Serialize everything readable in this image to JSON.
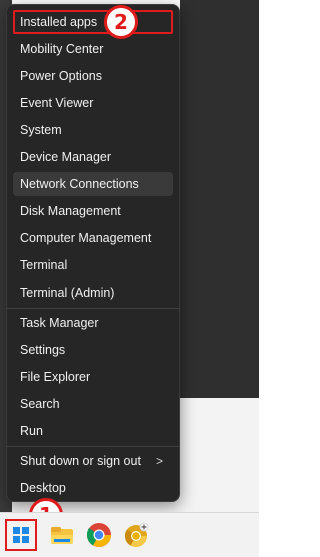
{
  "menu": {
    "items": [
      {
        "label": "Installed apps"
      },
      {
        "label": "Mobility Center"
      },
      {
        "label": "Power Options"
      },
      {
        "label": "Event Viewer"
      },
      {
        "label": "System"
      },
      {
        "label": "Device Manager"
      },
      {
        "label": "Network Connections"
      },
      {
        "label": "Disk Management"
      },
      {
        "label": "Computer Management"
      },
      {
        "label": "Terminal"
      },
      {
        "label": "Terminal (Admin)"
      },
      {
        "label": "Task Manager"
      },
      {
        "label": "Settings"
      },
      {
        "label": "File Explorer"
      },
      {
        "label": "Search"
      },
      {
        "label": "Run"
      },
      {
        "label": "Shut down or sign out"
      },
      {
        "label": "Desktop"
      }
    ],
    "submenu_glyph": ">"
  },
  "callouts": {
    "one": "1",
    "two": "2"
  },
  "colors": {
    "menu_bg": "#262626",
    "highlight_bg": "#3a3a3a",
    "callout_red": "#e01b1b",
    "win_blue": "#1e88e5"
  },
  "taskbar": {
    "icons": [
      "start-icon",
      "file-explorer-icon",
      "chrome-icon",
      "chrome-canary-icon"
    ]
  }
}
